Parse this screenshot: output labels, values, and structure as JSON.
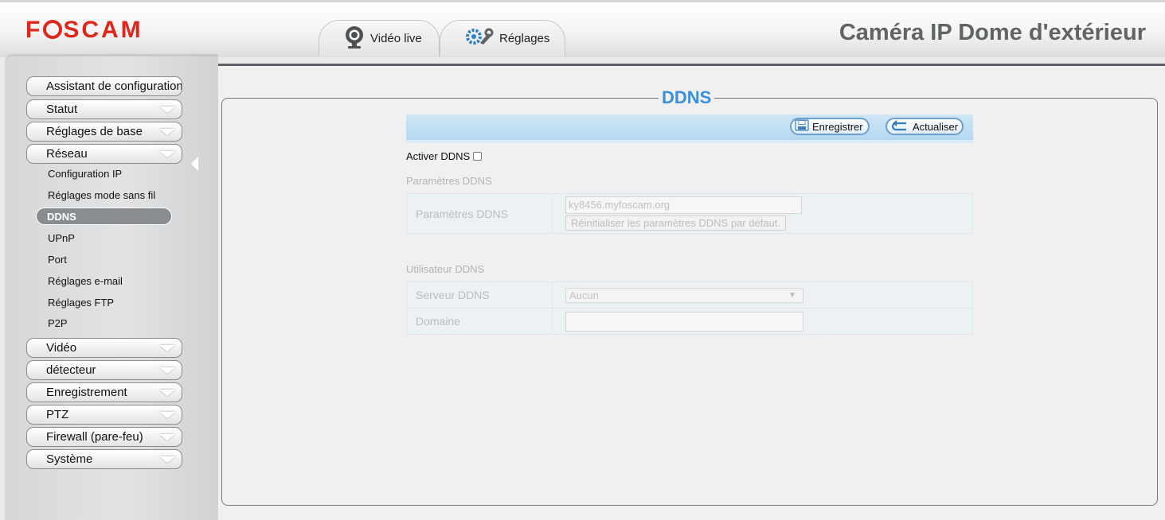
{
  "header": {
    "brand": "FOSCAM",
    "brand_pre": "F",
    "brand_post": "SCAM",
    "product_title": "Caméra IP Dome d'extérieur",
    "tabs": [
      {
        "label": "Vidéo live",
        "icon": "webcam-icon"
      },
      {
        "label": "Réglages",
        "icon": "gears-wrench-icon"
      }
    ]
  },
  "sidebar": {
    "top_items": [
      {
        "label": "Assistant de configuration"
      },
      {
        "label": "Statut"
      },
      {
        "label": "Réglages de base"
      },
      {
        "label": "Réseau"
      }
    ],
    "network_subitems": [
      {
        "label": "Configuration IP"
      },
      {
        "label": "Réglages mode sans fil"
      },
      {
        "label": "DDNS",
        "active": true
      },
      {
        "label": "UPnP"
      },
      {
        "label": "Port"
      },
      {
        "label": "Réglages e-mail"
      },
      {
        "label": "Réglages FTP"
      },
      {
        "label": "P2P"
      }
    ],
    "bottom_items": [
      {
        "label": "Vidéo"
      },
      {
        "label": "détecteur"
      },
      {
        "label": "Enregistrement"
      },
      {
        "label": "PTZ"
      },
      {
        "label": "Firewall (pare-feu)"
      },
      {
        "label": "Système"
      }
    ]
  },
  "main": {
    "title": "DDNS",
    "toolbar": {
      "save_label": "Enregistrer",
      "refresh_label": "Actualiser"
    },
    "enable_label": "Activer DDNS",
    "enable_checked": false,
    "ddns_params_section": "Paramètres DDNS",
    "ddns_params_row_label": "Paramètres DDNS",
    "ddns_domain_value": "ky8456.myfoscam.org",
    "reset_button_label": "Réinitialiser les paramètres DDNS par défaut.",
    "user_section": "Utilisateur DDNS",
    "server_label": "Serveur DDNS",
    "server_value": "Aucun",
    "domain_label": "Domaine",
    "domain_value": ""
  },
  "colors": {
    "brand_red": "#e0261b",
    "title_blue": "#3b8fd9",
    "toolbar_blue": "#b4d8ef"
  }
}
